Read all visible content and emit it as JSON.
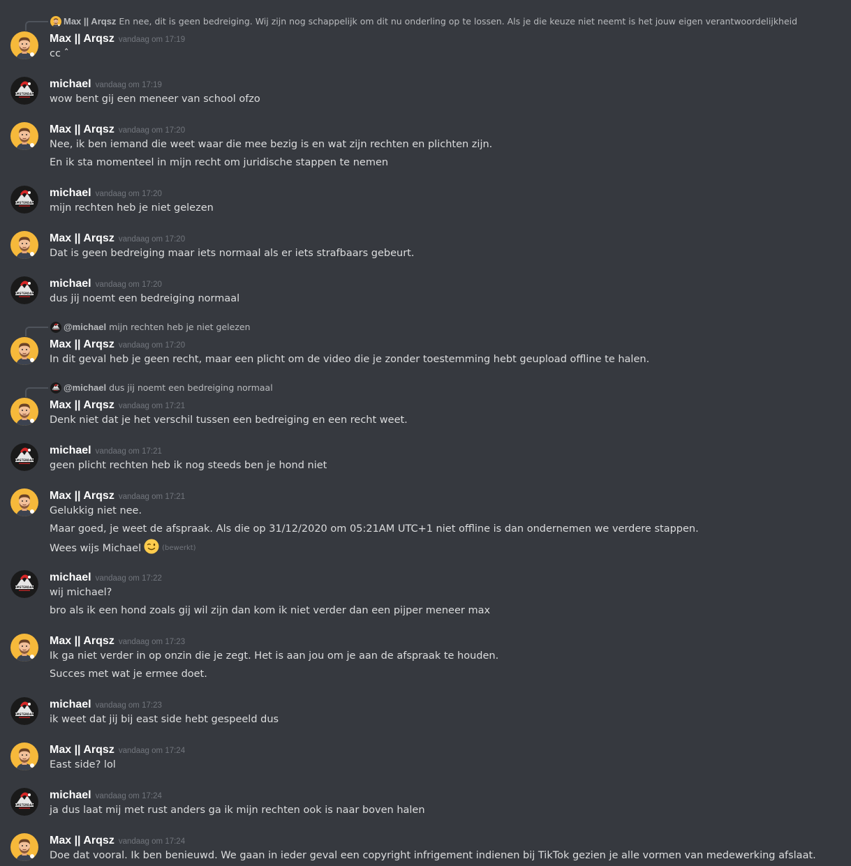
{
  "colors": {
    "background": "#36393f",
    "author": "#ffffff",
    "text": "#dcddde",
    "timestamp": "#72767d",
    "reply_text": "#b9bbbe"
  },
  "icons": {
    "max_avatar": "cartoon-man-avatar-icon",
    "michael_avatar": "amsterdam-logo-avatar-icon",
    "wink_emoji": "winking-face-emoji-icon"
  },
  "messages": [
    {
      "reply": {
        "author": "Max || Arqsz",
        "text": "En nee, dit is geen bedreiging. Wij zijn nog schappelijk om dit nu onderling op te lossen. Als je die keuze niet neemt is het jouw eigen verantwoordelijkheid"
      },
      "author": "Max || Arqsz",
      "time": "vandaag om 17:19",
      "lines": [
        "cc ˆ"
      ]
    },
    {
      "author": "michael",
      "time": "vandaag om 17:19",
      "lines": [
        "wow bent gij een meneer van school  ofzo"
      ]
    },
    {
      "author": "Max || Arqsz",
      "time": "vandaag om 17:20",
      "lines": [
        "Nee, ik ben iemand die weet waar die mee bezig is en wat zijn rechten en plichten zijn.",
        "En ik sta momenteel in mijn recht om juridische stappen te nemen"
      ]
    },
    {
      "author": "michael",
      "time": "vandaag om 17:20",
      "lines": [
        "mijn rechten heb je niet gelezen"
      ]
    },
    {
      "author": "Max || Arqsz",
      "time": "vandaag om 17:20",
      "lines": [
        "Dat is geen bedreiging maar iets normaal als er iets strafbaars gebeurt."
      ]
    },
    {
      "author": "michael",
      "time": "vandaag om 17:20",
      "lines": [
        "dus jij noemt een bedreiging normaal"
      ]
    },
    {
      "reply": {
        "author": "@michael",
        "text": "mijn rechten heb je niet gelezen"
      },
      "author": "Max || Arqsz",
      "time": "vandaag om 17:20",
      "lines": [
        "In dit geval heb je geen recht, maar een plicht om de video die je zonder toestemming hebt geupload offline te halen."
      ]
    },
    {
      "reply": {
        "author": "@michael",
        "text": "dus jij noemt een bedreiging normaal"
      },
      "author": "Max || Arqsz",
      "time": "vandaag om 17:21",
      "lines": [
        "Denk niet dat je het verschil tussen een bedreiging en een recht weet."
      ]
    },
    {
      "author": "michael",
      "time": "vandaag om 17:21",
      "lines": [
        "geen plicht rechten heb ik nog steeds ben je hond niet"
      ]
    },
    {
      "author": "Max || Arqsz",
      "time": "vandaag om 17:21",
      "lines": [
        "Gelukkig niet nee.",
        "Maar goed, je weet de afspraak. Als die op 31/12/2020 om 05:21AM UTC+1 niet offline is dan ondernemen we verdere stappen.",
        "Wees wijs Michael"
      ],
      "edited": "(bewerkt)"
    },
    {
      "author": "michael",
      "time": "vandaag om 17:22",
      "lines": [
        "wij michael?",
        "bro als ik een hond zoals gij wil zijn dan kom ik niet verder dan een pijper meneer max"
      ]
    },
    {
      "author": "Max || Arqsz",
      "time": "vandaag om 17:23",
      "lines": [
        "Ik ga niet verder in op onzin die je zegt. Het is aan jou om je aan de afspraak te houden.",
        "Succes met wat je ermee doet."
      ]
    },
    {
      "author": "michael",
      "time": "vandaag om 17:23",
      "lines": [
        "ik weet dat jij bij east side hebt gespeeld dus"
      ]
    },
    {
      "author": "Max || Arqsz",
      "time": "vandaag om 17:24",
      "lines": [
        "East side? lol"
      ]
    },
    {
      "author": "michael",
      "time": "vandaag om 17:24",
      "lines": [
        "ja dus laat mij met rust anders ga ik mijn rechten ook is naar boven halen"
      ]
    },
    {
      "author": "Max || Arqsz",
      "time": "vandaag om 17:24",
      "lines": [
        "Doe dat vooral. Ik ben benieuwd. We gaan in ieder geval een copyright infrigement indienen bij TikTok gezien je alle vormen van medewerking afslaat."
      ]
    }
  ]
}
